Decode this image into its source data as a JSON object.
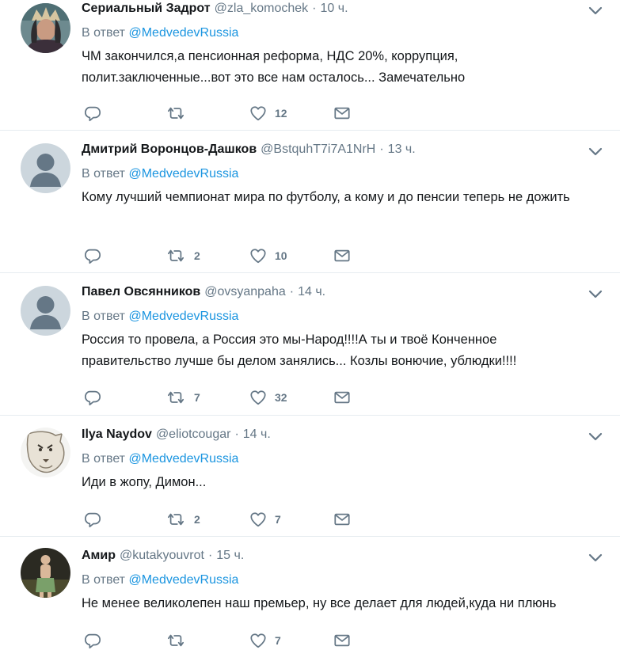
{
  "colors": {
    "link": "#1b95e0",
    "secondary": "#657786",
    "text": "#14171a",
    "divider": "#e6ecf0"
  },
  "icons": {
    "reply": "reply-icon",
    "retweet": "retweet-icon",
    "like": "heart-icon",
    "dm": "envelope-icon",
    "more": "chevron-down-icon"
  },
  "tweets": [
    {
      "name": "Сериальный Задрот",
      "handle": "@zla_komochek",
      "time": "10 ч.",
      "reply_prefix": "В ответ",
      "reply_to": "@MedvedevRussia",
      "text": "ЧМ закончился,а пенсионная реформа, НДС 20%, коррупция, полит.заключенные...вот это все нам осталось... Замечательно",
      "replies": "",
      "retweets": "",
      "likes": "12"
    },
    {
      "name": "Дмитрий Воронцов-Дашков",
      "handle": "@BstquhT7i7A1NrH",
      "time": "13 ч.",
      "reply_prefix": "В ответ",
      "reply_to": "@MedvedevRussia",
      "text": "Кому лучший чемпионат мира по футболу, а кому и до пенсии теперь не дожить",
      "replies": "",
      "retweets": "2",
      "likes": "10"
    },
    {
      "name": "Павел Овсянников",
      "handle": "@ovsyanpaha",
      "time": "14 ч.",
      "reply_prefix": "В ответ",
      "reply_to": "@MedvedevRussia",
      "text": "Россия то провела, а Россия это мы-Народ!!!!А ты и твоё Конченное правительство лучше бы делом занялись... Козлы вонючие, ублюдки!!!!",
      "replies": "",
      "retweets": "7",
      "likes": "32"
    },
    {
      "name": "Ilya Naydov",
      "handle": "@eliotcougar",
      "time": "14 ч.",
      "reply_prefix": "В ответ",
      "reply_to": "@MedvedevRussia",
      "text": "Иди в жопу, Димон...",
      "replies": "",
      "retweets": "2",
      "likes": "7"
    },
    {
      "name": "Амир",
      "handle": "@kutakyouvrot",
      "time": "15 ч.",
      "reply_prefix": "В ответ",
      "reply_to": "@MedvedevRussia",
      "text": "Не менее великолепен наш премьер, ну все делает для людей,куда ни плюнь",
      "replies": "",
      "retweets": "",
      "likes": "7"
    }
  ]
}
